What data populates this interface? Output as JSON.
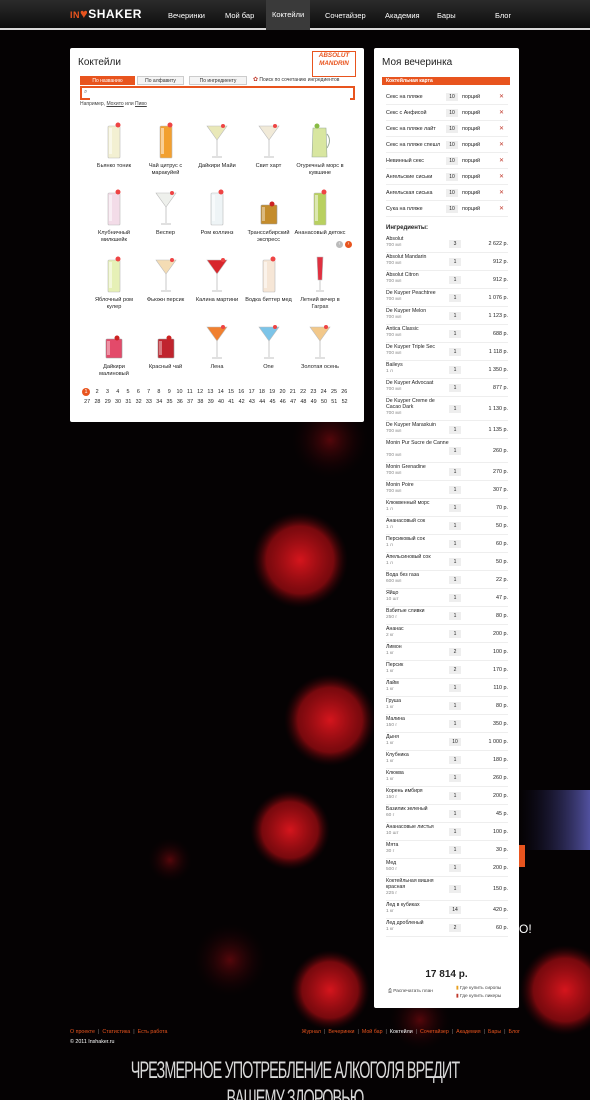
{
  "logo": {
    "pre": "IN",
    "post": "SHAKER"
  },
  "nav": [
    "Вечеринки",
    "Мой бар",
    "Коктейли",
    "Сочетайзер",
    "Академия",
    "Бары",
    "Блог"
  ],
  "nav_active": 2,
  "cocktails_panel": {
    "title": "Коктейли",
    "brand": "ABSOLUT MANDRIN",
    "tabs": [
      "По названию",
      "По алфавиту",
      "По ингредиенту"
    ],
    "combo_label": "Поиск по сочетанию ингредиентов",
    "search_placeholder": "",
    "hint_prefix": "Например,",
    "hint_link1": "Мохито",
    "hint_or": "или",
    "hint_link2": "Пиво"
  },
  "cocktails": [
    {
      "name": "Бьянко тоник",
      "color": "#f3f0d2",
      "glass": "tall"
    },
    {
      "name": "Чай цитрус с маракуйей",
      "color": "#f2a030",
      "glass": "tall"
    },
    {
      "name": "Дайкири Майи",
      "color": "#e9e8b8",
      "glass": "martini"
    },
    {
      "name": "Свит харт",
      "color": "#f1ead8",
      "glass": "martini"
    },
    {
      "name": "Огуречный морс в кувшине",
      "color": "#d8e6a0",
      "glass": "jug"
    },
    {
      "name": "Клубничный милкшейк",
      "color": "#f3dce8",
      "glass": "tall"
    },
    {
      "name": "Веспер",
      "color": "#eef0ec",
      "glass": "martini"
    },
    {
      "name": "Ром коллинз",
      "color": "#eef4f6",
      "glass": "tall"
    },
    {
      "name": "Транссибирский экспресс",
      "color": "#c48c2c",
      "glass": "rocks"
    },
    {
      "name": "Ананасовый детокс",
      "color": "#b8d060",
      "glass": "tall"
    },
    {
      "name": "Яблочный ром кулер",
      "color": "#e6f0b6",
      "glass": "tall"
    },
    {
      "name": "Фьюжн персик",
      "color": "#f4dcb4",
      "glass": "martini"
    },
    {
      "name": "Калина мартини",
      "color": "#d8262c",
      "glass": "martini"
    },
    {
      "name": "Водка биттер мед",
      "color": "#f6e6d6",
      "glass": "tall"
    },
    {
      "name": "Летний вечер в Гаграх",
      "color": "#e03040",
      "glass": "flute"
    },
    {
      "name": "Дайкири малиновый",
      "color": "#e34a6a",
      "glass": "rocks"
    },
    {
      "name": "Красный чай",
      "color": "#c0242e",
      "glass": "rocks"
    },
    {
      "name": "Лена",
      "color": "#f08030",
      "glass": "martini"
    },
    {
      "name": "One",
      "color": "#7cc4e8",
      "glass": "martini"
    },
    {
      "name": "Золотая осень",
      "color": "#f2c88a",
      "glass": "martini"
    }
  ],
  "pager": [
    "1",
    "2",
    "3",
    "4",
    "5",
    "6",
    "7",
    "8",
    "9",
    "10",
    "11",
    "12",
    "13",
    "14",
    "15",
    "16",
    "17",
    "18",
    "19",
    "20",
    "21",
    "22",
    "23",
    "24",
    "25",
    "26",
    "27",
    "28",
    "29",
    "30",
    "31",
    "32",
    "33",
    "34",
    "35",
    "36",
    "37",
    "38",
    "39",
    "40",
    "41",
    "42",
    "43",
    "44",
    "45",
    "46",
    "47",
    "48",
    "49",
    "50",
    "51",
    "52"
  ],
  "party_panel": {
    "title": "Моя вечеринка",
    "card_label": "Коктейльная карта",
    "unit": "порций",
    "ing_label": "Ингредиенты:",
    "total": "17 814 р.",
    "print_label": "Распечатать план",
    "buy_syrups": "Где купить сиропы",
    "buy_liqueurs": "Где купить ликеры"
  },
  "party_cocktails": [
    {
      "name": "Секс на пляже",
      "qty": "10"
    },
    {
      "name": "Секс с Анфисой",
      "qty": "10"
    },
    {
      "name": "Секс на пляже лайт",
      "qty": "10"
    },
    {
      "name": "Секс на пляже спешл",
      "qty": "10"
    },
    {
      "name": "Невинный секс",
      "qty": "10"
    },
    {
      "name": "Ангельские сиськи",
      "qty": "10"
    },
    {
      "name": "Ангельская сиська",
      "qty": "10"
    },
    {
      "name": "Сука на пляже",
      "qty": "10"
    }
  ],
  "ingredients": [
    {
      "name": "Absolut",
      "vol": "700 мл",
      "qty": "3",
      "price": "2 622 р."
    },
    {
      "name": "Absolut Mandarin",
      "vol": "700 мл",
      "qty": "1",
      "price": "912 р."
    },
    {
      "name": "Absolut Citron",
      "vol": "700 мл",
      "qty": "1",
      "price": "912 р."
    },
    {
      "name": "De Kuyper Peachtree",
      "vol": "700 мл",
      "qty": "1",
      "price": "1 076 р."
    },
    {
      "name": "De Kuyper Melon",
      "vol": "700 мл",
      "qty": "1",
      "price": "1 123 р."
    },
    {
      "name": "Antica Classic",
      "vol": "700 мл",
      "qty": "1",
      "price": "688 р."
    },
    {
      "name": "De Kuyper Triple Sec",
      "vol": "700 мл",
      "qty": "1",
      "price": "1 118 р."
    },
    {
      "name": "Baileys",
      "vol": "1 л",
      "qty": "1",
      "price": "1 350 р."
    },
    {
      "name": "De Kuyper Advocaat",
      "vol": "700 мл",
      "qty": "1",
      "price": "877 р."
    },
    {
      "name": "De Kuyper Creme de Cacao Dark",
      "vol": "700 мл",
      "qty": "1",
      "price": "1 130 р.",
      "two": true
    },
    {
      "name": "De Kuyper Maraskuin",
      "vol": "700 мл",
      "qty": "1",
      "price": "1 135 р."
    },
    {
      "name": "Monin Pur Sucre de Canne",
      "vol": "700 мл",
      "qty": "1",
      "price": "260 р.",
      "two": true
    },
    {
      "name": "Monin Grenadine",
      "vol": "700 мл",
      "qty": "1",
      "price": "270 р."
    },
    {
      "name": "Monin Poire",
      "vol": "700 мл",
      "qty": "1",
      "price": "307 р."
    },
    {
      "name": "Клюквенный морс",
      "vol": "1 л",
      "qty": "1",
      "price": "70 р."
    },
    {
      "name": "Ананасовый сок",
      "vol": "1 л",
      "qty": "1",
      "price": "50 р."
    },
    {
      "name": "Персиковый сок",
      "vol": "1 л",
      "qty": "1",
      "price": "60 р."
    },
    {
      "name": "Апельсиновый сок",
      "vol": "1 л",
      "qty": "1",
      "price": "50 р."
    },
    {
      "name": "Вода без газа",
      "vol": "600 мл",
      "qty": "1",
      "price": "22 р."
    },
    {
      "name": "Яйцо",
      "vol": "10 шт",
      "qty": "1",
      "price": "47 р."
    },
    {
      "name": "Взбитые сливки",
      "vol": "250 г",
      "qty": "1",
      "price": "80 р."
    },
    {
      "name": "Ананас",
      "vol": "2 кг",
      "qty": "1",
      "price": "200 р."
    },
    {
      "name": "Лимон",
      "vol": "1 кг",
      "qty": "2",
      "price": "100 р."
    },
    {
      "name": "Персик",
      "vol": "1 кг",
      "qty": "2",
      "price": "170 р."
    },
    {
      "name": "Лайм",
      "vol": "1 кг",
      "qty": "1",
      "price": "110 р."
    },
    {
      "name": "Груша",
      "vol": "1 кг",
      "qty": "1",
      "price": "80 р."
    },
    {
      "name": "Малина",
      "vol": "150 г",
      "qty": "1",
      "price": "350 р."
    },
    {
      "name": "Дыня",
      "vol": "1 кг",
      "qty": "10",
      "price": "1 000 р."
    },
    {
      "name": "Клубника",
      "vol": "1 кг",
      "qty": "1",
      "price": "180 р."
    },
    {
      "name": "Клюква",
      "vol": "1 кг",
      "qty": "1",
      "price": "260 р."
    },
    {
      "name": "Корень имбиря",
      "vol": "150 г",
      "qty": "1",
      "price": "200 р."
    },
    {
      "name": "Базилик зеленый",
      "vol": "60 г",
      "qty": "1",
      "price": "45 р."
    },
    {
      "name": "Ананасовые листья",
      "vol": "10 шт",
      "qty": "1",
      "price": "100 р."
    },
    {
      "name": "Мята",
      "vol": "30 г",
      "qty": "1",
      "price": "30 р."
    },
    {
      "name": "Мед",
      "vol": "500 г",
      "qty": "1",
      "price": "200 р."
    },
    {
      "name": "Коктейльная вишня красная",
      "vol": "225 г",
      "qty": "1",
      "price": "150 р.",
      "two": true
    },
    {
      "name": "Лед в кубиках",
      "vol": "1 кг",
      "qty": "14",
      "price": "420 р."
    },
    {
      "name": "Лед дробленый",
      "vol": "1 кг",
      "qty": "2",
      "price": "60 р."
    }
  ],
  "footer": {
    "left": [
      "О проекте",
      "Статистика",
      "Есть работа"
    ],
    "right": [
      "Журнал",
      "Вечеринки",
      "Мой бар",
      "Коктейли",
      "Сочетайзер",
      "Академия",
      "Бары",
      "Блог"
    ],
    "right_current": 3,
    "copyright": "© 2011 Inshaker.ru",
    "warning": "ЧРЕЗМЕРНОЕ УПОТРЕБЛЕНИЕ АЛКОГОЛЯ ВРЕДИТ ВАШЕМУ ЗДОРОВЬЮ"
  },
  "colors": {
    "accent": "#e8541e",
    "bokeh": "#d4141e",
    "remove": "#c0392b"
  }
}
